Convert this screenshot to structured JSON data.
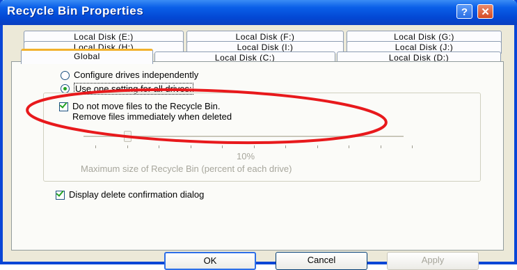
{
  "window": {
    "title": "Recycle Bin Properties",
    "help_glyph": "?",
    "close_glyph": "✕"
  },
  "tabs": {
    "row1": [
      "Local Disk (E:)",
      "Local Disk (F:)",
      "Local Disk (G:)"
    ],
    "row2": [
      "Local Disk (H:)",
      "Local Disk (I:)",
      "Local Disk (J:)"
    ],
    "row3": [
      "Global",
      "Local Disk (C:)",
      "Local Disk (D:)"
    ],
    "selected": "Global"
  },
  "options": {
    "configure_independently": "Configure drives independently",
    "use_one_setting": "Use one setting for all drives:",
    "selected": "use_one_setting"
  },
  "settings": {
    "dont_move_line1": "Do not move files to the Recycle Bin.",
    "dont_move_line2": "Remove files immediately when deleted",
    "dont_move_checked": true,
    "slider_value_label": "10%",
    "slider_value_percent": 10,
    "max_size_label": "Maximum size of Recycle Bin (percent of each drive)",
    "display_confirmation": "Display delete confirmation dialog",
    "display_confirmation_checked": true
  },
  "buttons": {
    "ok": "OK",
    "cancel": "Cancel",
    "apply": "Apply"
  },
  "colors": {
    "title_bar": "#0a5fe8",
    "highlight_ellipse": "#e8191c",
    "check": "#21a121"
  }
}
